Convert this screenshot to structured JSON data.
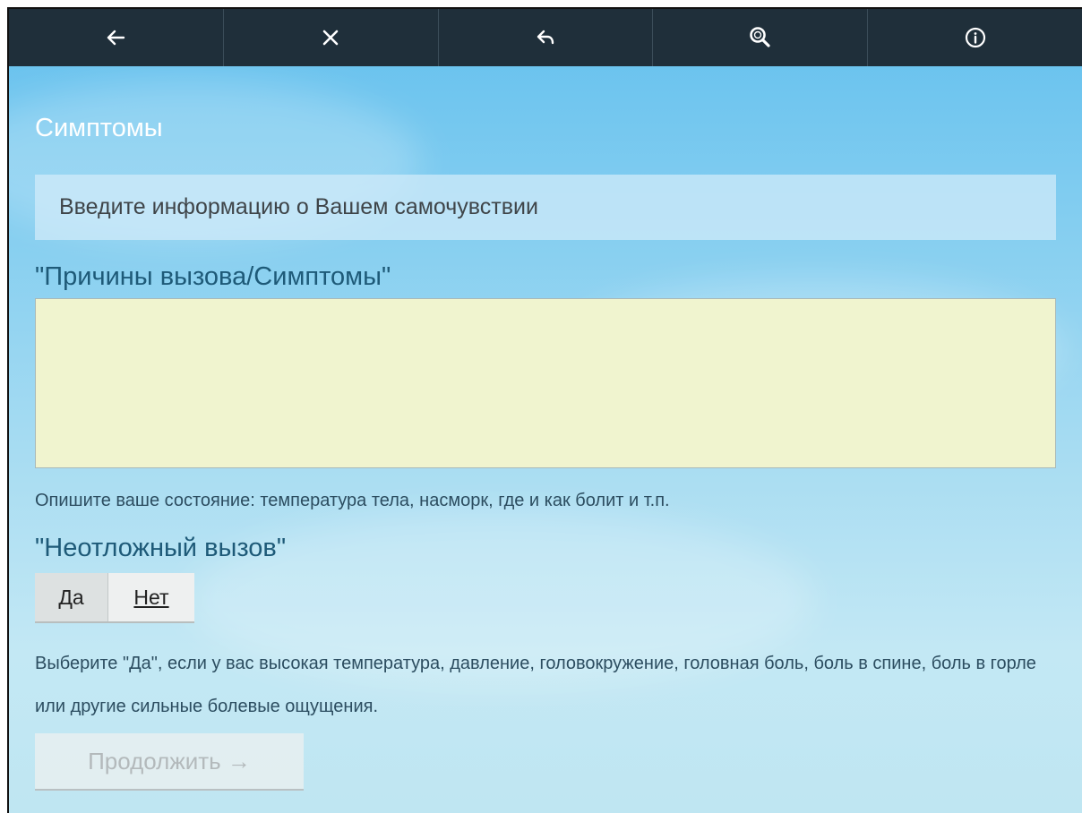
{
  "toolbar": {
    "items": [
      {
        "icon": "arrow-left-icon",
        "glyph": "←"
      },
      {
        "icon": "close-icon",
        "glyph": "✕"
      },
      {
        "icon": "undo-icon",
        "glyph": "↩"
      },
      {
        "icon": "search-icon",
        "glyph": "🔍"
      },
      {
        "icon": "info-icon",
        "glyph": "ⓘ"
      }
    ],
    "background": "#1f2f3a"
  },
  "page": {
    "title": "Симптомы",
    "info_banner": "Введите информацию о Вашем самочувствии"
  },
  "symptoms": {
    "label": "\"Причины вызова/Симптомы\"",
    "value": "",
    "hint": "Опишите ваше состояние: температура тела, насморк, где и как болит и т.п."
  },
  "urgent": {
    "label": "\"Неотложный вызов\"",
    "yes_label": "Да",
    "no_label": "Нет",
    "hint": "Выберите \"Да\", если у вас высокая температура, давление, головокружение, головная боль, боль в спине, боль в горле или другие сильные болевые ощущения."
  },
  "actions": {
    "continue_label": "Продолжить →",
    "continue_enabled": false
  },
  "colors": {
    "label_text": "#1e5a78",
    "textarea_bg": "#f0f4cf",
    "title_text": "#ffffff"
  }
}
